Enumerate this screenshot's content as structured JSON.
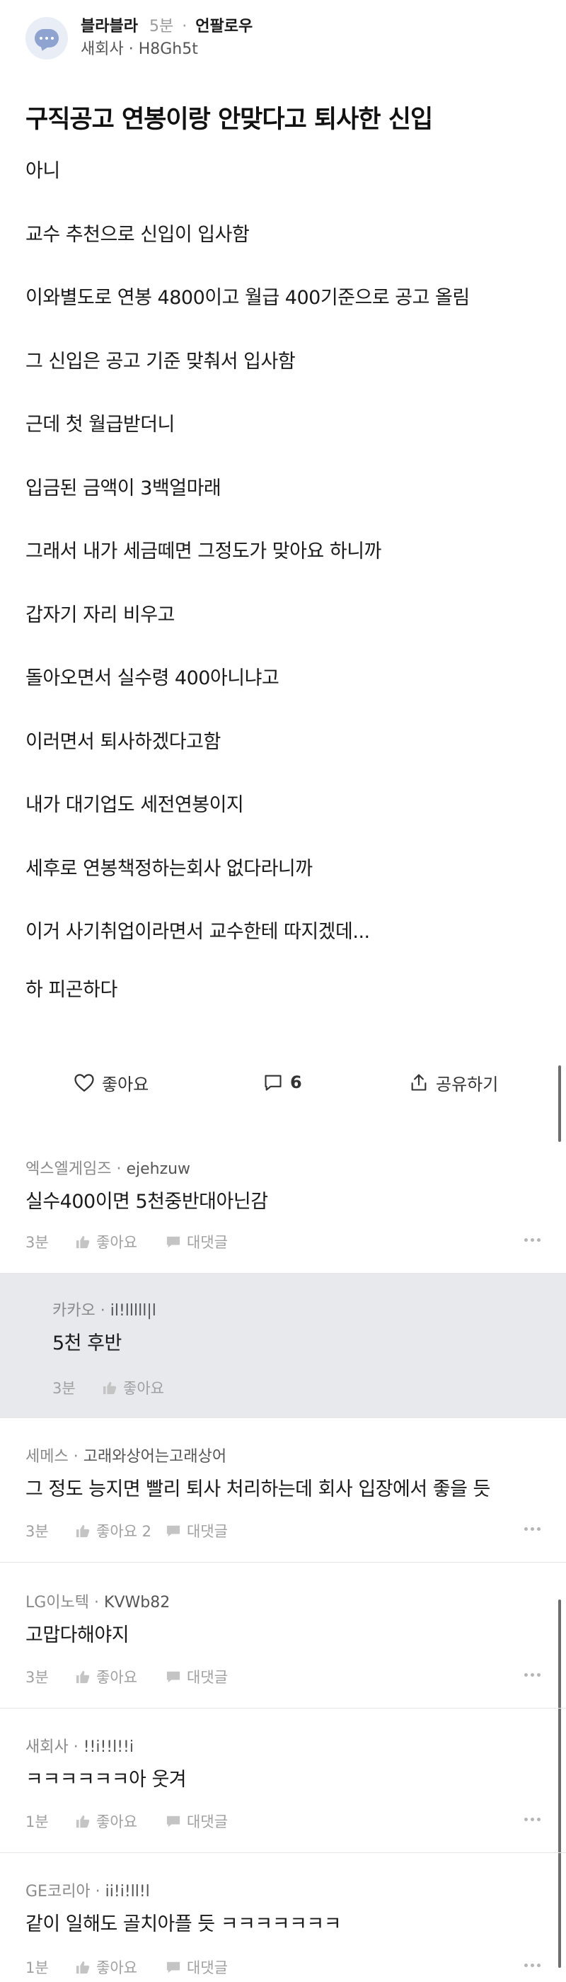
{
  "author": {
    "name": "블라블라",
    "time": "5분",
    "follow_label": "언팔로우",
    "company": "새회사",
    "user_id": "H8Gh5t"
  },
  "post": {
    "title": "구직공고 연봉이랑 안맞다고 퇴사한 신입",
    "lines": [
      "아니",
      "교수 추천으로 신입이 입사함",
      "이와별도로 연봉 4800이고 월급 400기준으로 공고 올림",
      "그 신입은 공고 기준 맞춰서 입사함",
      "근데 첫 월급받더니",
      "입금된 금액이 3백얼마래",
      "그래서 내가 세금떼면 그정도가 맞아요 하니까",
      "갑자기 자리 비우고",
      "돌아오면서 실수령 400아니냐고",
      "이러면서 퇴사하겠다고함",
      "내가 대기업도 세전연봉이지",
      "세후로 연봉책정하는회사 없다라니까",
      "이거 사기취업이라면서 교수한테 따지겠데...",
      "하 피곤하다"
    ]
  },
  "actions": {
    "like_label": "좋아요",
    "comment_count": "6",
    "share_label": "공유하기"
  },
  "comments": [
    {
      "company": "엑스엘게임즈",
      "user": "ejehzuw",
      "text": "실수400이면 5천중반대아닌감",
      "time": "3분",
      "like": "좋아요",
      "reply": "대댓글"
    },
    {
      "company": "카카오",
      "user": "il!lllll|l",
      "text": "5천 후반",
      "time": "3분",
      "like": "좋아요",
      "reply": ""
    },
    {
      "company": "세메스",
      "user": "고래와상어는고래상어",
      "text": "그 정도 능지면 빨리 퇴사 처리하는데 회사 입장에서 좋을 듯",
      "time": "3분",
      "like": "좋아요 2",
      "reply": "대댓글"
    },
    {
      "company": "LG이노텍",
      "user": "KVWb82",
      "text": "고맙다해야지",
      "time": "3분",
      "like": "좋아요",
      "reply": "대댓글"
    },
    {
      "company": "새회사",
      "user": "!!i!!l!!i",
      "text": "ㅋㅋㅋㅋㅋㅋ아 웃겨",
      "time": "1분",
      "like": "좋아요",
      "reply": "대댓글"
    },
    {
      "company": "GE코리아",
      "user": "ii!i!ll!l",
      "text": "같이 일해도 골치아플 듯 ㅋㅋㅋㅋㅋㅋㅋ",
      "time": "1분",
      "like": "좋아요",
      "reply": "대댓글"
    }
  ],
  "colors": {
    "accent": "#8ea3d0",
    "reply_bg": "#e7e9ed",
    "meta_text": "#8a8a8a"
  }
}
